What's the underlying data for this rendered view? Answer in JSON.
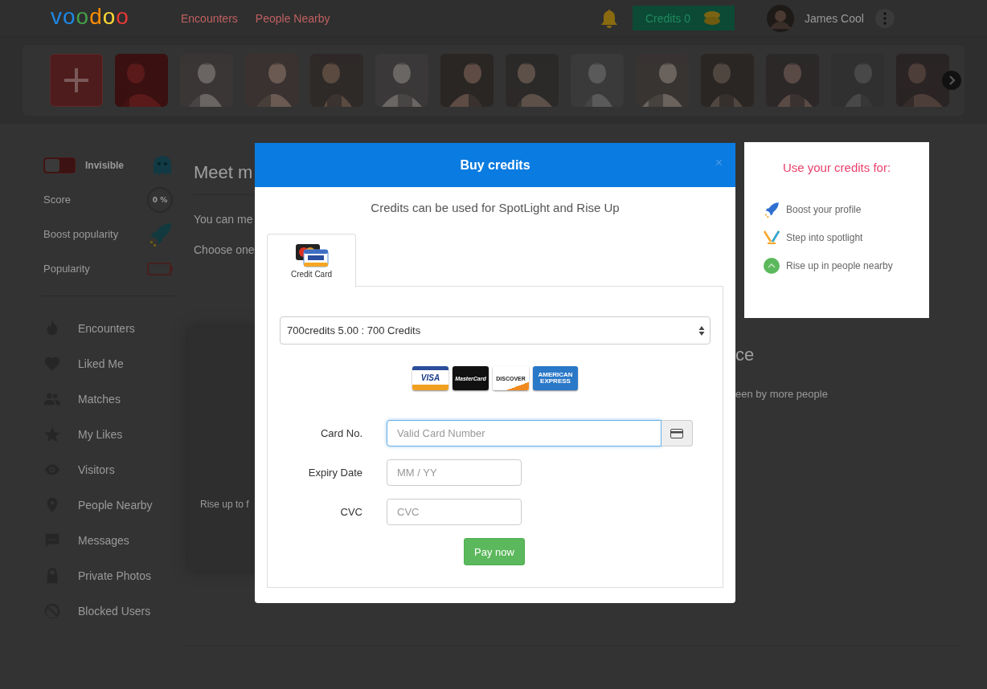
{
  "header": {
    "logo": "voodoo",
    "nav": [
      {
        "label": "Encounters"
      },
      {
        "label": "People Nearby"
      }
    ],
    "credits_button": "Credits 0",
    "user_name": "James Cool"
  },
  "sidebar": {
    "invisible_toggle": {
      "label": "Invisible",
      "on": false
    },
    "score": {
      "label": "Score",
      "value": "0 %"
    },
    "boost": {
      "label": "Boost popularity"
    },
    "popularity": {
      "label": "Popularity"
    },
    "menu": [
      {
        "label": "Encounters"
      },
      {
        "label": "Liked Me"
      },
      {
        "label": "Matches"
      },
      {
        "label": "My Likes"
      },
      {
        "label": "Visitors"
      },
      {
        "label": "People Nearby"
      },
      {
        "label": "Messages"
      },
      {
        "label": "Private Photos"
      },
      {
        "label": "Blocked Users"
      }
    ]
  },
  "main": {
    "heading": "Meet m",
    "lines": [
      "You can me",
      "Choose one"
    ],
    "card_text": "Rise up to f",
    "right_heading": "ce",
    "right_text": "een by more people"
  },
  "modal": {
    "title": "Buy credits",
    "close": "×",
    "subtitle": "Credits can be used for SpotLight and Rise Up",
    "tabs": [
      {
        "label": "Credit Card",
        "selected": true
      }
    ],
    "package": "700credits 5.00 : 700 Credits",
    "card_brands": [
      {
        "label": "VISA"
      },
      {
        "label": "MasterCard"
      },
      {
        "label": "DISCOVER"
      },
      {
        "label": "AMERICAN EXPRESS"
      }
    ],
    "fields": [
      {
        "label": "Card No.",
        "placeholder": "Valid Card Number",
        "focused": true
      },
      {
        "label": "Expiry Date",
        "placeholder": "MM / YY",
        "focused": false
      },
      {
        "label": "CVC",
        "placeholder": "CVC",
        "focused": false
      }
    ],
    "submit": "Pay now"
  },
  "side_panel": {
    "title": "Use your credits for:",
    "items": [
      {
        "label": "Boost your profile"
      },
      {
        "label": "Step into spotlight"
      },
      {
        "label": "Rise up in people nearby"
      }
    ]
  }
}
